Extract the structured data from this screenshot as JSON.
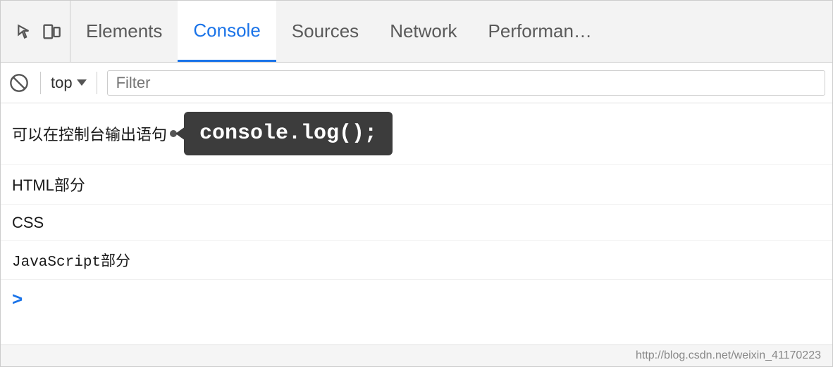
{
  "tabs": {
    "icons": {
      "inspect_label": "inspect-icon",
      "device_label": "device-icon"
    },
    "items": [
      {
        "label": "Elements",
        "active": false
      },
      {
        "label": "Console",
        "active": true
      },
      {
        "label": "Sources",
        "active": false
      },
      {
        "label": "Network",
        "active": false
      },
      {
        "label": "Performan…",
        "active": false
      }
    ]
  },
  "toolbar": {
    "no_icon_label": "🚫",
    "context": "top",
    "filter_placeholder": "Filter"
  },
  "console": {
    "rows": [
      {
        "text": "可以在控制台输出语句",
        "monospace": false,
        "has_bullet": true,
        "tooltip": "console.log();"
      },
      {
        "text": "HTML部分",
        "monospace": false,
        "has_bullet": false
      },
      {
        "text": "CSS",
        "monospace": false,
        "has_bullet": false
      },
      {
        "text": "JavaScript部分",
        "monospace": true,
        "has_bullet": false
      }
    ],
    "prompt_chevron": ">"
  },
  "footer": {
    "link": "http://blog.csdn.net/weixin_41170223"
  }
}
